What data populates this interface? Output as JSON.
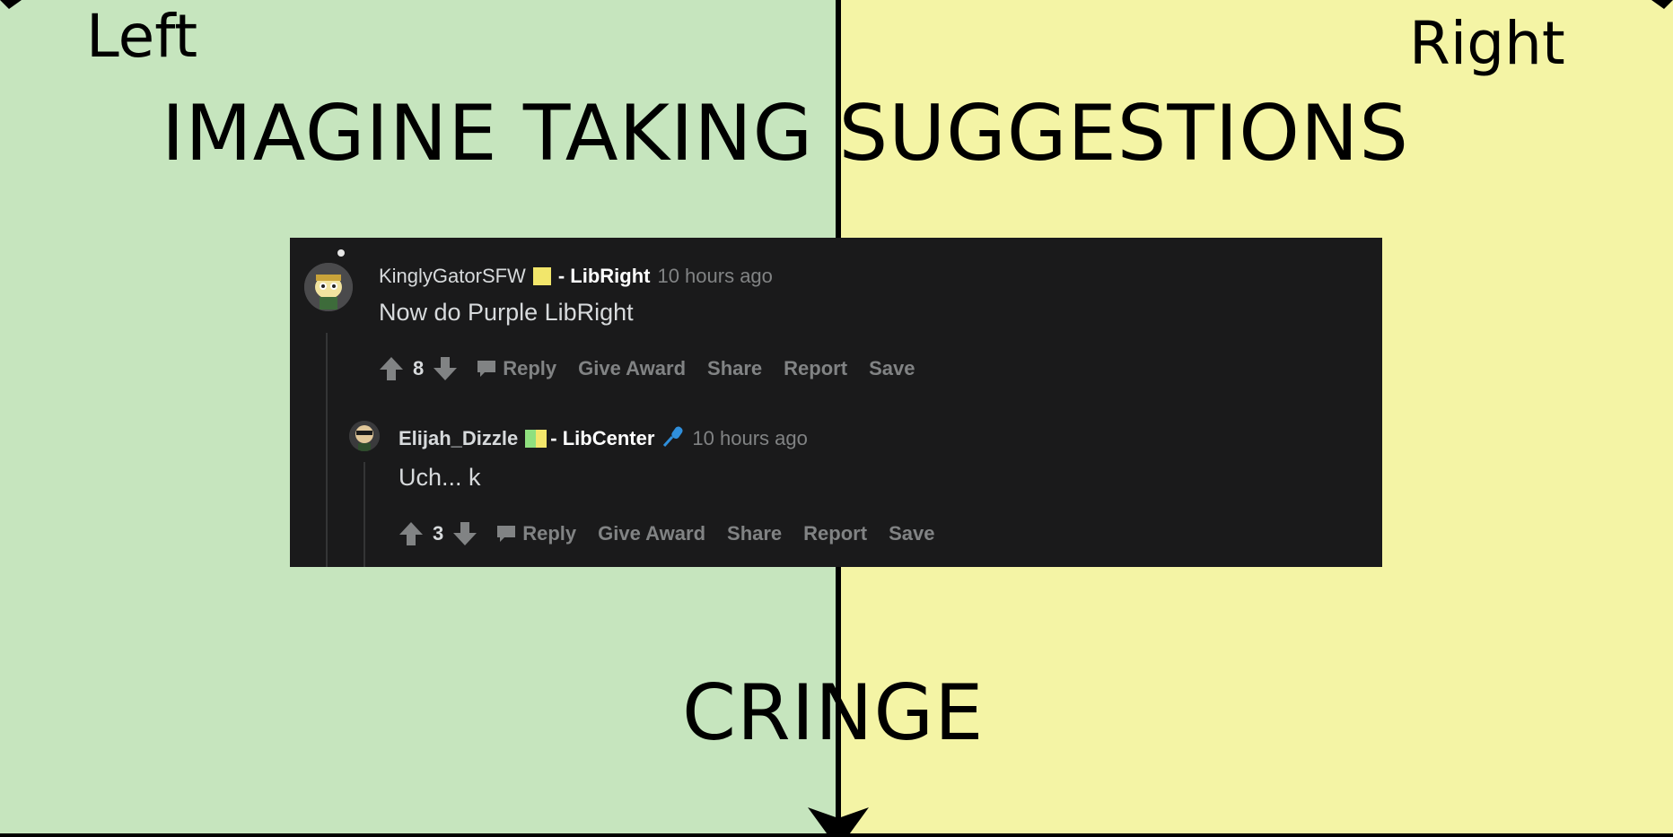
{
  "chart_labels": {
    "left": "Left",
    "right": "Right",
    "title": "IMAGINE TAKING SUGGESTIONS",
    "bottom": "CRINGE"
  },
  "colors": {
    "left_quadrant": "#c6e5be",
    "right_quadrant": "#f4f4a5",
    "comment_bg": "#1a1a1b"
  },
  "comments": [
    {
      "username": "KinglyGatorSFW",
      "flair": "- LibRight",
      "time": "10 hours ago",
      "body": "Now do Purple LibRight",
      "score": "8",
      "actions": [
        "Reply",
        "Give Award",
        "Share",
        "Report",
        "Save"
      ]
    },
    {
      "username": "Elijah_Dizzle",
      "flair": "- LibCenter",
      "time": "10 hours ago",
      "body": "Uch... k",
      "score": "3",
      "actions": [
        "Reply",
        "Give Award",
        "Share",
        "Report",
        "Save"
      ]
    }
  ],
  "icons": [
    "upvote-icon",
    "downvote-icon",
    "reply-icon",
    "microphone-icon",
    "avatar-icon"
  ]
}
